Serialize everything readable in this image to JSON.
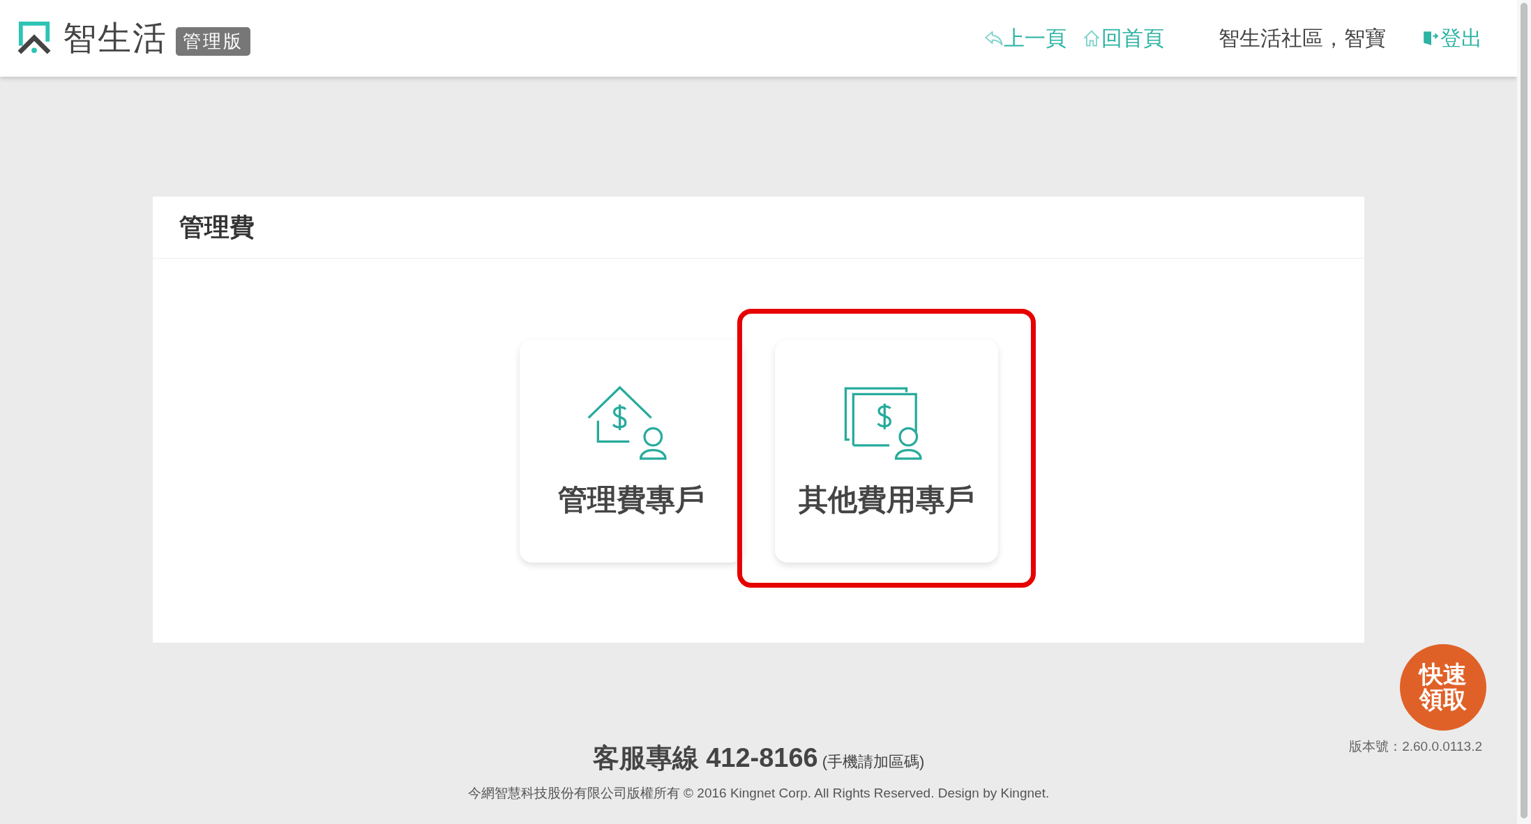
{
  "header": {
    "brand": "智生活",
    "badge": "管理版",
    "nav": [
      {
        "kind": "back",
        "label": "上一頁"
      },
      {
        "kind": "home",
        "label": "回首頁"
      }
    ],
    "user": "智生活社區，智寶",
    "logout": "登出"
  },
  "panel": {
    "title": "管理費",
    "cards": [
      {
        "kind": "house",
        "label": "管理費專戶",
        "highlighted": false
      },
      {
        "kind": "bills",
        "label": "其他費用專戶",
        "highlighted": true
      }
    ]
  },
  "quick_button": {
    "lines": [
      "快速",
      "領取"
    ]
  },
  "version": "版本號：2.60.0.0113.2",
  "footer": {
    "hotline": "客服專線 412-8166",
    "hotline_note": "(手機請加區碼)",
    "copyright": "今網智慧科技股份有限公司版權所有 © 2016 Kingnet Corp. All Rights Reserved. Design by Kingnet."
  }
}
